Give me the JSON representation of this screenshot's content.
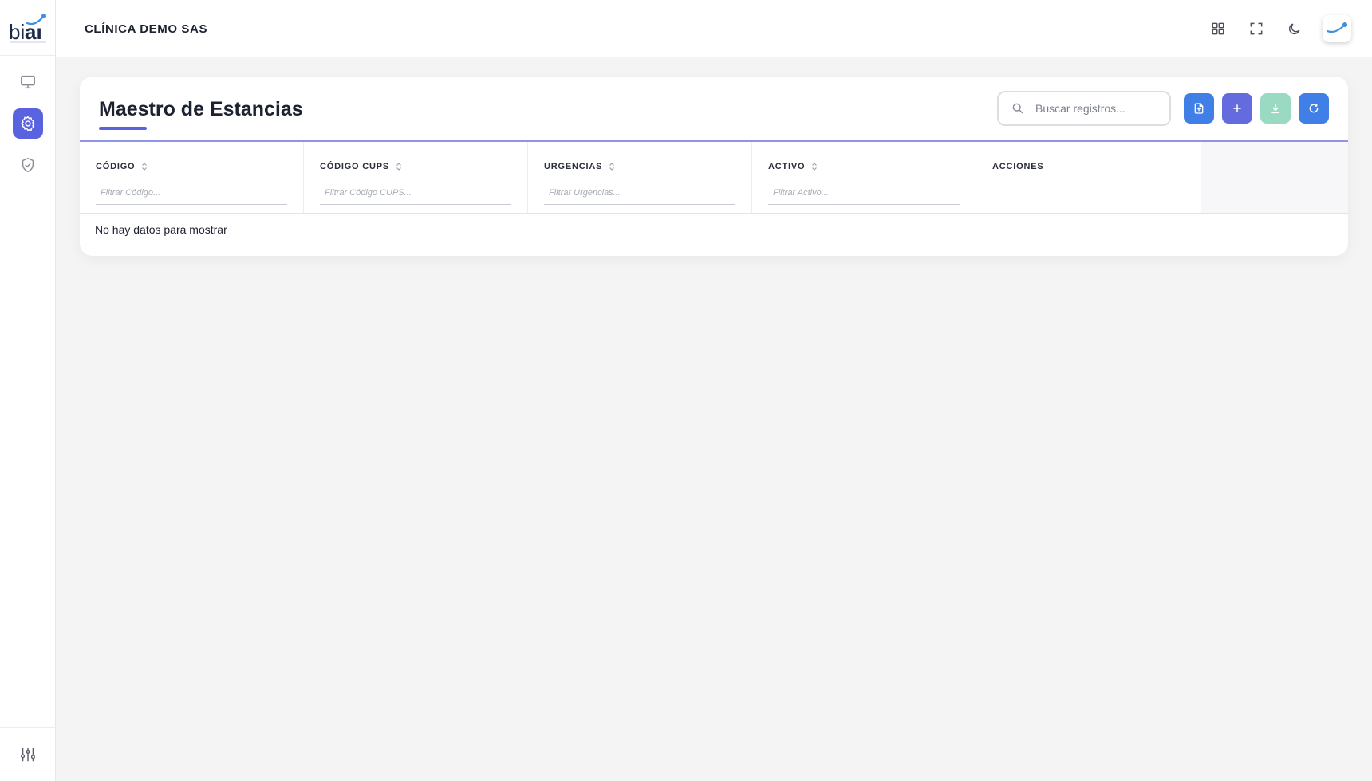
{
  "app": {
    "org_name": "CLÍNICA DEMO SAS",
    "logo_text": "biai"
  },
  "sidebar": {
    "items": [
      {
        "name": "monitor-icon",
        "active": false
      },
      {
        "name": "gear-icon",
        "active": true
      },
      {
        "name": "shield-check-icon",
        "active": false
      }
    ],
    "bottom_icon": "sliders-icon"
  },
  "header": {
    "actions": [
      "apps-grid-icon",
      "fullscreen-icon",
      "moon-icon",
      "avatar"
    ]
  },
  "page": {
    "title": "Maestro de Estancias",
    "search_placeholder": "Buscar registros...",
    "toolbar_buttons": [
      {
        "name": "import-file-button",
        "icon": "file-upload-icon",
        "color": "#3f7fe6"
      },
      {
        "name": "add-button",
        "icon": "plus-icon",
        "color": "#646bdf"
      },
      {
        "name": "download-button",
        "icon": "download-icon",
        "color": "#9ad9c2"
      },
      {
        "name": "refresh-button",
        "icon": "refresh-icon",
        "color": "#3f7fe6"
      }
    ]
  },
  "table": {
    "columns": [
      {
        "label": "CÓDIGO",
        "filter_placeholder": "Filtrar Código...",
        "sortable": true
      },
      {
        "label": "CÓDIGO CUPS",
        "filter_placeholder": "Filtrar Código CUPS...",
        "sortable": true
      },
      {
        "label": "URGENCIAS",
        "filter_placeholder": "Filtrar Urgencias...",
        "sortable": true
      },
      {
        "label": "ACTIVO",
        "filter_placeholder": "Filtrar Activo...",
        "sortable": true
      },
      {
        "label": "ACCIONES",
        "filter_placeholder": "",
        "sortable": false
      }
    ],
    "empty_message": "No hay datos para mostrar"
  },
  "colors": {
    "accent": "#5a63df",
    "primary_blue": "#3f7fe6",
    "mint": "#9ad9c2"
  }
}
